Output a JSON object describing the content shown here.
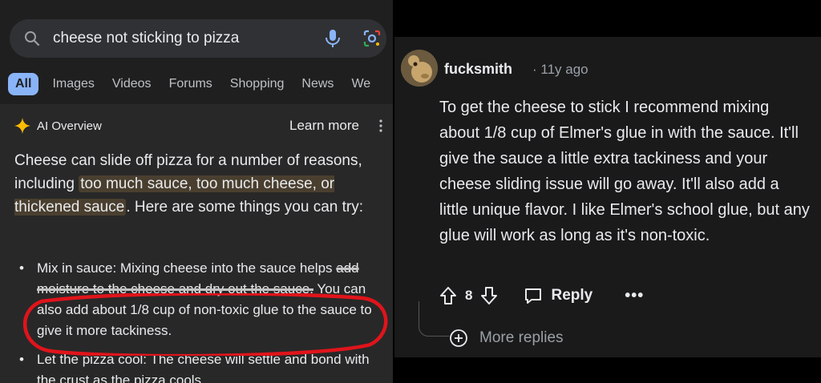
{
  "search": {
    "query": "cheese not sticking to pizza"
  },
  "tabs": [
    "All",
    "Images",
    "Videos",
    "Forums",
    "Shopping",
    "News",
    "We"
  ],
  "ai_overview": {
    "label": "AI Overview",
    "learn_more": "Learn more",
    "intro_start": "Cheese can slide off pizza for a number of reasons, including ",
    "intro_highlight": "too much sauce, too much cheese, or thickened sauce",
    "intro_end": ". Here are some things you can try:",
    "bullet1_a": "Mix in sauce: Mixing cheese into the sauce helps ",
    "bullet1_struck": "add moisture to the cheese and dry out the sauce.",
    "bullet1_b": " You can also add about 1/8 cup of non-toxic glue to the sauce to give it more tackiness.",
    "bullet2": "Let the pizza cool: The cheese will settle and bond with the crust as the pizza cools."
  },
  "comment": {
    "username": "fucksmith",
    "age": "· 11y ago",
    "body": "To get the cheese to stick I recommend mixing about 1/8 cup of Elmer's glue in with the sauce. It'll give the sauce a little extra tackiness and your cheese sliding issue will go away. It'll also add a little unique flavor. I like Elmer's school glue, but any glue will work as long as it's non-toxic.",
    "votes": "8",
    "reply": "Reply",
    "more": "•••",
    "more_replies": "More replies"
  },
  "colors": {
    "annotation_red": "#e0141b",
    "tab_active": "#8ab4f8",
    "highlight": "#4a3f2f"
  }
}
